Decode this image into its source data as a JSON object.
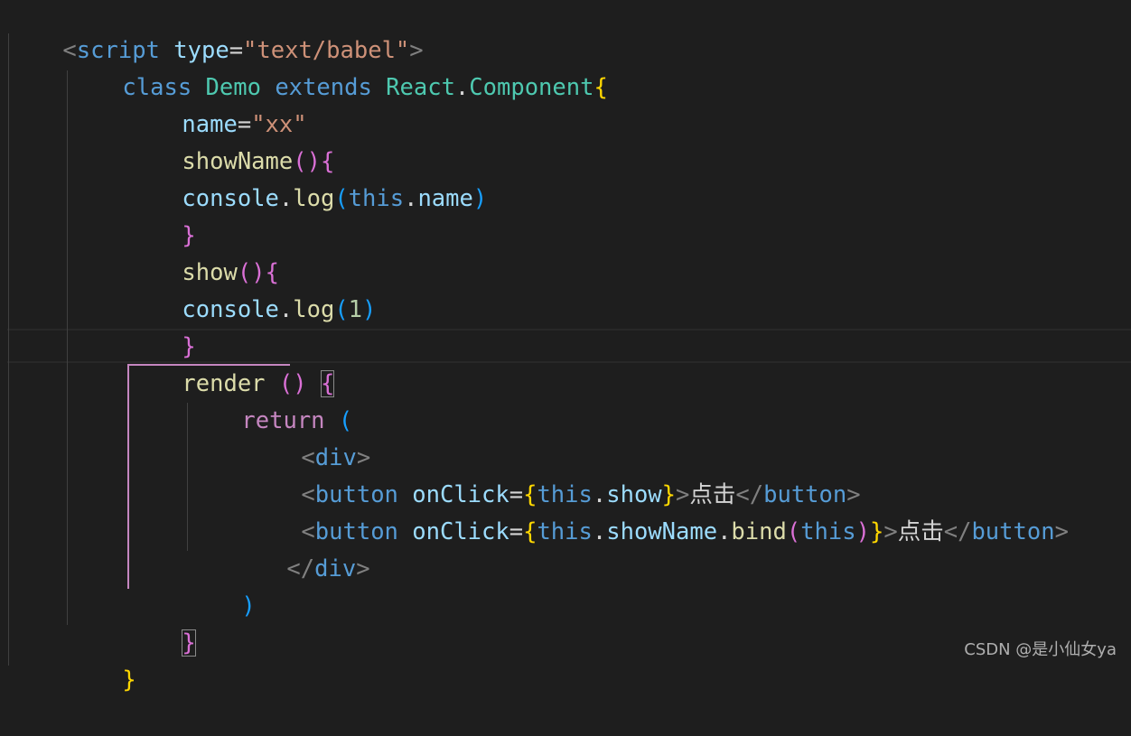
{
  "editor": {
    "lines": [
      {
        "tokens": [
          "<",
          "script",
          " ",
          "type",
          "=",
          "\"text/babel\"",
          ">"
        ]
      },
      {
        "tokens": [
          "class",
          " ",
          "Demo",
          " ",
          "extends",
          " ",
          "React",
          ".",
          "Component",
          "{"
        ]
      },
      {
        "tokens": [
          "name",
          "=",
          "\"xx\""
        ]
      },
      {
        "tokens": [
          "showName",
          "(",
          ")",
          "{"
        ]
      },
      {
        "tokens": [
          "console",
          ".",
          "log",
          "(",
          "this",
          ".",
          "name",
          ")"
        ]
      },
      {
        "tokens": [
          "}"
        ]
      },
      {
        "tokens": [
          "show",
          "(",
          ")",
          "{"
        ]
      },
      {
        "tokens": [
          "console",
          ".",
          "log",
          "(",
          "1",
          ")"
        ]
      },
      {
        "tokens": [
          "}"
        ]
      },
      {
        "tokens": [
          "render",
          " ",
          "(",
          ")",
          " ",
          "{"
        ]
      },
      {
        "tokens": [
          "return",
          " ",
          "("
        ]
      },
      {
        "tokens": [
          "<",
          "div",
          ">"
        ]
      },
      {
        "tokens": [
          "<",
          "button",
          " ",
          "onClick",
          "=",
          "{",
          "this",
          ".",
          "show",
          "}",
          ">",
          "点击",
          "</",
          "button",
          ">"
        ]
      },
      {
        "tokens": [
          "<",
          "button",
          " ",
          "onClick",
          "=",
          "{",
          "this",
          ".",
          "showName",
          ".",
          "bind",
          "(",
          "this",
          ")",
          "}",
          ">",
          "点击",
          "</",
          "button",
          ">"
        ]
      },
      {
        "tokens": [
          "</",
          "div",
          ">"
        ]
      },
      {
        "tokens": [
          ")"
        ]
      },
      {
        "tokens": [
          "}"
        ]
      },
      {
        "tokens": [
          "}"
        ]
      }
    ]
  },
  "watermark": "CSDN @是小仙女ya"
}
